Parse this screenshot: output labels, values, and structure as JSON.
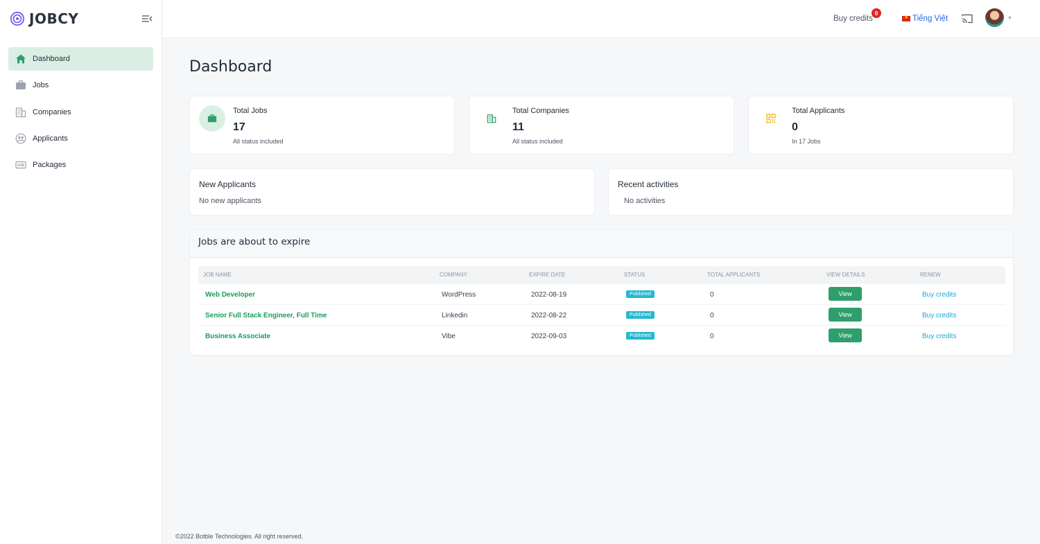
{
  "brand": {
    "name": "JOBCY"
  },
  "sidebar": {
    "items": [
      {
        "label": "Dashboard",
        "icon": "home-icon",
        "active": true
      },
      {
        "label": "Jobs",
        "icon": "briefcase-icon"
      },
      {
        "label": "Companies",
        "icon": "building-icon"
      },
      {
        "label": "Applicants",
        "icon": "users-icon"
      },
      {
        "label": "Packages",
        "icon": "package-icon"
      }
    ]
  },
  "topbar": {
    "buy_credits": "Buy credits",
    "credits_count": "0",
    "language": "Tiếng Việt"
  },
  "page": {
    "title": "Dashboard"
  },
  "stats": [
    {
      "label": "Total Jobs",
      "value": "17",
      "sub": "All status included",
      "icon": "briefcase-icon"
    },
    {
      "label": "Total Companies",
      "value": "11",
      "sub": "All status included",
      "icon": "building-icon"
    },
    {
      "label": "Total Applicants",
      "value": "0",
      "sub": "In 17 Jobs",
      "icon": "qrcode-icon"
    }
  ],
  "new_applicants": {
    "title": "New Applicants",
    "empty": "No new applicants"
  },
  "recent_activities": {
    "title": "Recent activities",
    "empty": "No activities"
  },
  "expiring_jobs": {
    "title": "Jobs are about to expire",
    "columns": [
      "Job Name",
      "Company",
      "Expire Date",
      "Status",
      "Total Applicants",
      "View Details",
      "Renew"
    ],
    "rows": [
      {
        "job": "Web Developer",
        "company": "WordPress",
        "expire": "2022-08-19",
        "status": "Published",
        "applicants": "0",
        "action": "View",
        "renew": "Buy credits"
      },
      {
        "job": "Senior Full Stack Engineer, Full Time",
        "company": "Linkedin",
        "expire": "2022-08-22",
        "status": "Published",
        "applicants": "0",
        "action": "View",
        "renew": "Buy credits"
      },
      {
        "job": "Business Associate",
        "company": "Vibe",
        "expire": "2022-09-03",
        "status": "Published",
        "applicants": "0",
        "action": "View",
        "renew": "Buy credits"
      }
    ]
  },
  "footer": {
    "text": "©2022 Botble Technologies. All right reserved."
  },
  "colors": {
    "accent": "#2e9e6b",
    "active_bg": "#d9efe4",
    "link_blue": "#1aa6d8",
    "status_badge": "#25b8d0",
    "warning": "#f5b800"
  }
}
